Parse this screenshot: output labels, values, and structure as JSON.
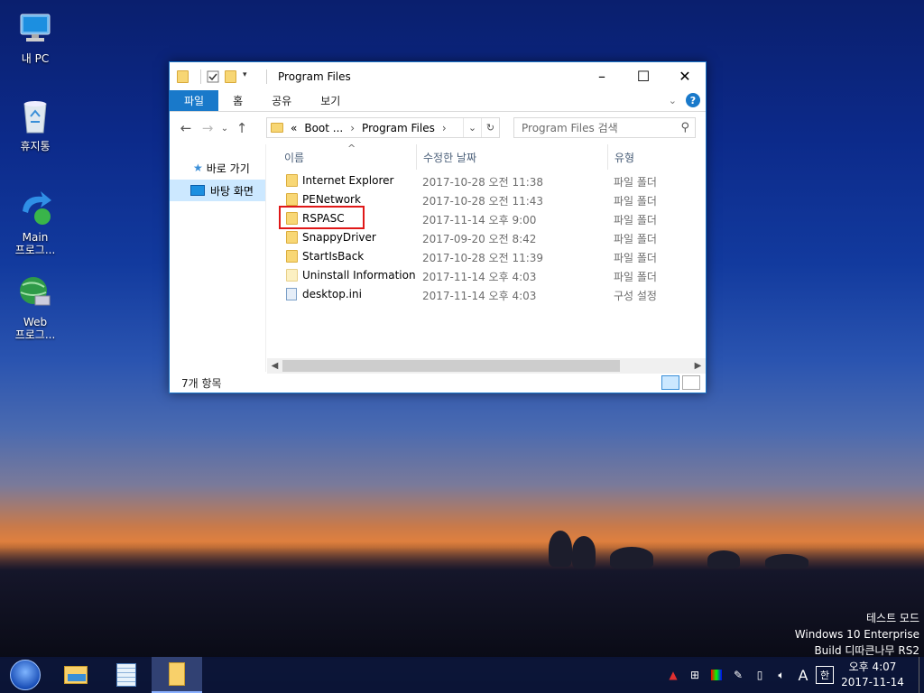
{
  "desktop": {
    "icons": [
      {
        "label": "내 PC",
        "icon": "this-pc-icon"
      },
      {
        "label": "휴지통",
        "icon": "recycle-bin-icon"
      },
      {
        "label": "Main\n프로그...",
        "line1": "Main",
        "line2": "프로그..."
      },
      {
        "label": "Web\n프로그...",
        "line1": "Web",
        "line2": "프로그..."
      }
    ]
  },
  "window": {
    "title": "Program Files",
    "ribbon_tabs": [
      "파일",
      "홈",
      "공유",
      "보기"
    ],
    "help": "?",
    "address": {
      "prefix": "«",
      "crumbs": [
        "Boot ...",
        "Program Files"
      ]
    },
    "search_placeholder": "Program Files 검색",
    "nav_pane": [
      {
        "label": "바로 가기",
        "icon": "star-icon"
      },
      {
        "label": "바탕 화면",
        "icon": "desktop-icon",
        "selected": true
      }
    ],
    "columns": {
      "name": "이름",
      "date": "수정한 날짜",
      "type": "유형"
    },
    "files": [
      {
        "name": "Internet Explorer",
        "date": "2017-10-28 오전 11:38",
        "type": "파일 폴더",
        "kind": "folder"
      },
      {
        "name": "PENetwork",
        "date": "2017-10-28 오전 11:43",
        "type": "파일 폴더",
        "kind": "folder"
      },
      {
        "name": "RSPASC",
        "date": "2017-11-14 오후 9:00",
        "type": "파일 폴더",
        "kind": "folder"
      },
      {
        "name": "SnappyDriver",
        "date": "2017-09-20 오전 8:42",
        "type": "파일 폴더",
        "kind": "folder"
      },
      {
        "name": "StartIsBack",
        "date": "2017-10-28 오전 11:39",
        "type": "파일 폴더",
        "kind": "folder"
      },
      {
        "name": "Uninstall Information",
        "date": "2017-11-14 오후 4:03",
        "type": "파일 폴더",
        "kind": "folder-light"
      },
      {
        "name": "desktop.ini",
        "date": "2017-11-14 오후 4:03",
        "type": "구성 설정",
        "kind": "ini"
      }
    ],
    "status": "7개 항목"
  },
  "watermark": [
    "테스트 모드",
    "Windows 10 Enterprise",
    "Build 디따큰나무 RS2"
  ],
  "taskbar": {
    "tray_lang": "A",
    "tray_ime": "한",
    "time": "오후 4:07",
    "date": "2017-11-14"
  },
  "colors": {
    "accent": "#1979ca",
    "highlight_box": "#e01818",
    "selection": "#cce8ff"
  }
}
